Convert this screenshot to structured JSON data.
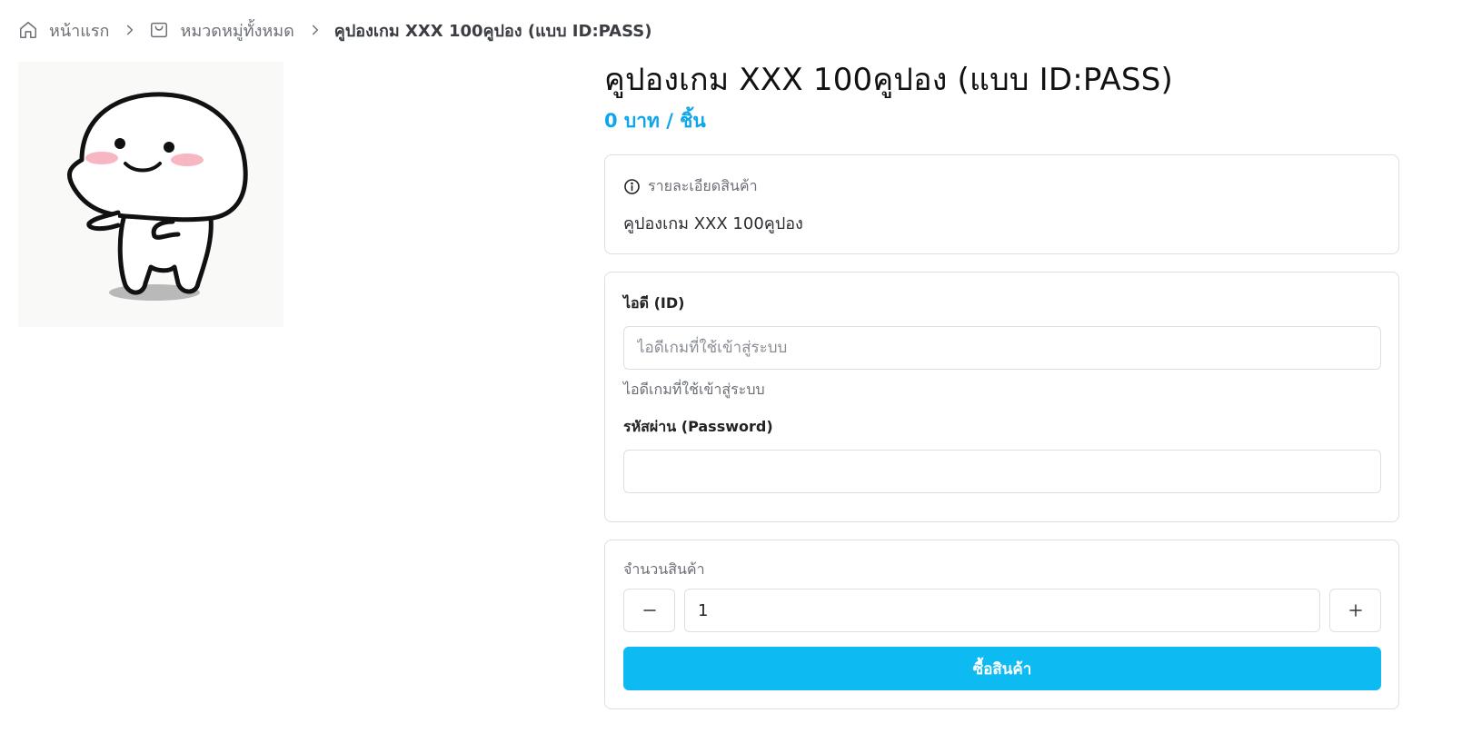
{
  "breadcrumb": {
    "home": "หน้าแรก",
    "categories": "หมวดหมู่ทั้งหมด",
    "current": "คูปองเกม XXX 100คูปอง (แบบ ID:PASS)"
  },
  "product": {
    "title": "คูปองเกม XXX 100คูปอง (แบบ ID:PASS)",
    "price": "0 บาท / ชิ้น",
    "description_heading": "รายละเอียดสินค้า",
    "description": "คูปองเกม XXX 100คูปอง"
  },
  "form": {
    "id_label": "ไอดี (ID)",
    "id_placeholder": "ไอดีเกมที่ใช้เข้าสู่ระบบ",
    "id_value": "",
    "id_help": "ไอดีเกมที่ใช้เข้าสู่ระบบ",
    "password_label": "รหัสผ่าน (Password)",
    "password_value": ""
  },
  "quantity": {
    "label": "จำนวนสินค้า",
    "value": "1",
    "minus_icon": "minus-icon",
    "plus_icon": "plus-icon"
  },
  "buy_button": "ซื้อสินค้า",
  "colors": {
    "accent": "#0ebaf2",
    "price": "#0ea5e9",
    "border": "#dcdfe3",
    "muted_text": "#6b6f76"
  },
  "icons": {
    "home": "home-icon",
    "category": "shopping-bag-icon",
    "separator": "chevron-right-icon",
    "info": "info-icon"
  }
}
